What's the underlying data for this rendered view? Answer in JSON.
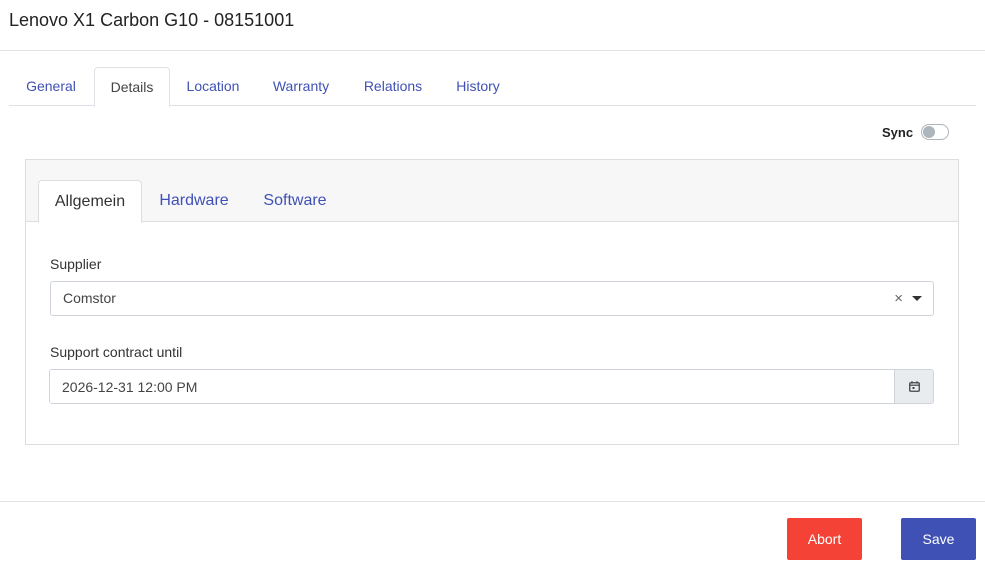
{
  "header": {
    "title": "Lenovo X1 Carbon G10 - 08151001"
  },
  "outer_tabs": [
    {
      "label": "General"
    },
    {
      "label": "Details",
      "active": true
    },
    {
      "label": "Location"
    },
    {
      "label": "Warranty"
    },
    {
      "label": "Relations"
    },
    {
      "label": "History"
    }
  ],
  "sync": {
    "label": "Sync",
    "enabled": false
  },
  "inner_tabs": [
    {
      "label": "Allgemein",
      "active": true
    },
    {
      "label": "Hardware"
    },
    {
      "label": "Software"
    }
  ],
  "form": {
    "supplier": {
      "label": "Supplier",
      "value": "Comstor",
      "clear_glyph": "×"
    },
    "support_contract": {
      "label": "Support contract until",
      "value": "2026-12-31 12:00 PM"
    }
  },
  "footer": {
    "abort_label": "Abort",
    "save_label": "Save"
  },
  "colors": {
    "accent": "#3f51b5",
    "danger": "#f44336"
  },
  "icons": {
    "calendar": "calendar-icon",
    "caret": "caret-down-icon",
    "clear": "clear-icon"
  }
}
